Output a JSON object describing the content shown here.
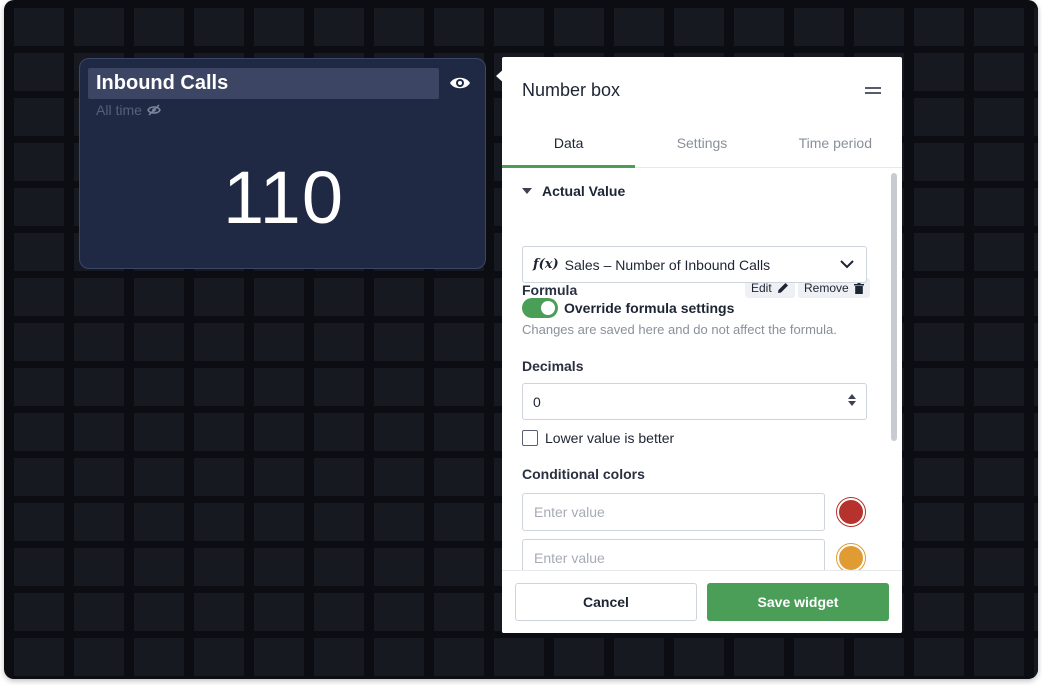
{
  "widget": {
    "title": "Inbound Calls",
    "period": "All time",
    "value": "110"
  },
  "panel": {
    "title": "Number box",
    "tabs": [
      {
        "label": "Data",
        "active": true
      },
      {
        "label": "Settings",
        "active": false
      },
      {
        "label": "Time period",
        "active": false
      }
    ],
    "section": "Actual Value",
    "formula": {
      "label": "Formula",
      "edit_label": "Edit",
      "remove_label": "Remove",
      "value": "Sales – Number of Inbound Calls"
    },
    "override": {
      "label": "Override formula settings",
      "hint": "Changes are saved here and do not affect the formula.",
      "enabled": true
    },
    "decimals": {
      "label": "Decimals",
      "value": "0"
    },
    "lower_better": {
      "label": "Lower value is better",
      "checked": false
    },
    "conditional_colors": {
      "label": "Conditional colors",
      "placeholder": "Enter value",
      "colors": [
        "#b6322c",
        "#e09c33"
      ]
    },
    "cancel_label": "Cancel",
    "save_label": "Save widget"
  },
  "colors": {
    "accent": "#4a9e57",
    "widget_bg": "#1f2944",
    "canvas_bg": "#0b0d12"
  }
}
